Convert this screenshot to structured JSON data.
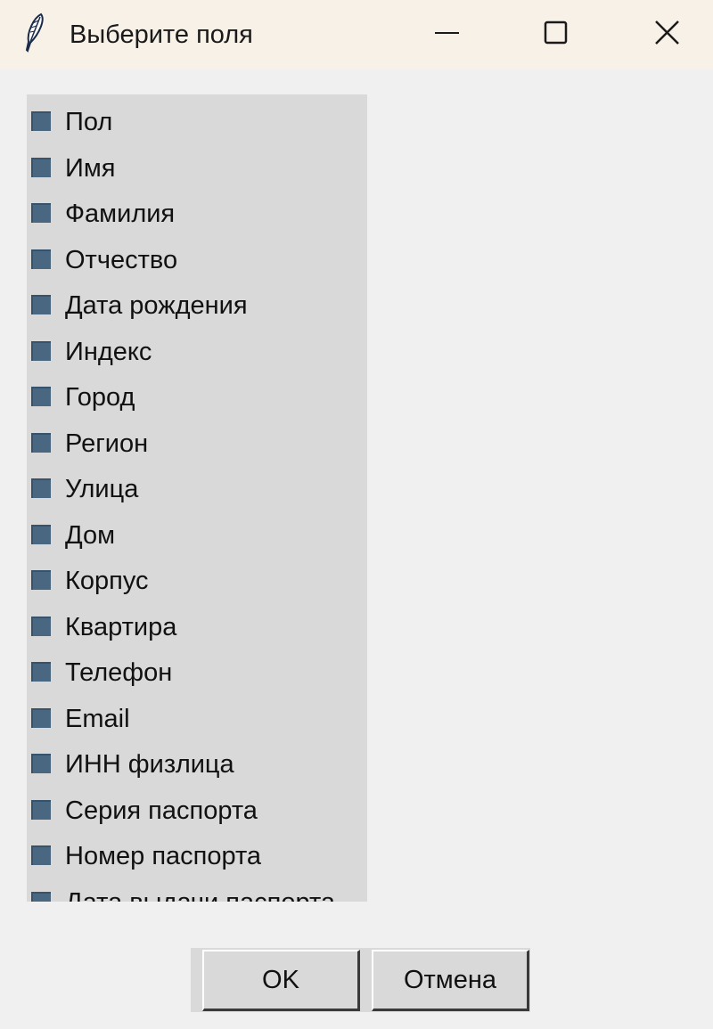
{
  "window": {
    "title": "Выберите поля"
  },
  "icons": {
    "app": "feather-icon",
    "minimize": "minimize-icon",
    "maximize": "maximize-icon",
    "close": "close-icon"
  },
  "fields": [
    {
      "label": "Пол",
      "checked": false
    },
    {
      "label": "Имя",
      "checked": false
    },
    {
      "label": "Фамилия",
      "checked": false
    },
    {
      "label": "Отчество",
      "checked": false
    },
    {
      "label": "Дата рождения",
      "checked": false
    },
    {
      "label": "Индекс",
      "checked": false
    },
    {
      "label": "Город",
      "checked": false
    },
    {
      "label": "Регион",
      "checked": false
    },
    {
      "label": "Улица",
      "checked": false
    },
    {
      "label": "Дом",
      "checked": false
    },
    {
      "label": "Корпус",
      "checked": false
    },
    {
      "label": "Квартира",
      "checked": false
    },
    {
      "label": "Телефон",
      "checked": false
    },
    {
      "label": "Email",
      "checked": false
    },
    {
      "label": "ИНН физлица",
      "checked": false
    },
    {
      "label": "Серия паспорта",
      "checked": false
    },
    {
      "label": "Номер паспорта",
      "checked": false
    },
    {
      "label": "Дата выдачи паспорта",
      "checked": false
    }
  ],
  "buttons": {
    "ok": "OK",
    "cancel": "Отмена"
  },
  "colors": {
    "titlebar": "#f8f1e8",
    "list_background": "#d9d9d9",
    "checkbox_fill": "#4a6781"
  }
}
